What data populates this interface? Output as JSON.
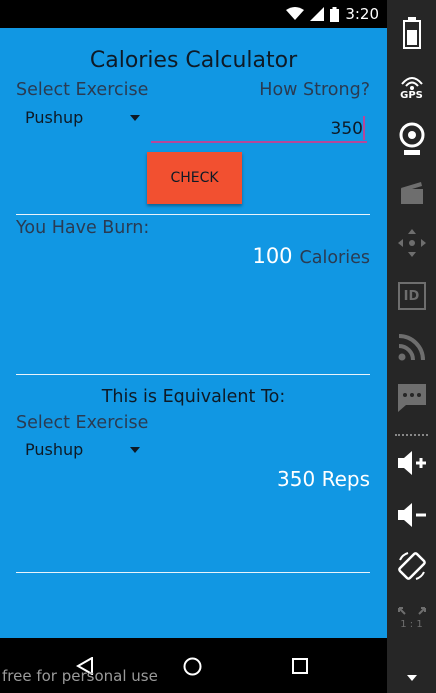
{
  "status_bar": {
    "time": "3:20"
  },
  "app": {
    "title": "Calories Calculator",
    "select_exercise_label": "Select Exercise",
    "strength_label": "How Strong?",
    "exercise_selected": "Pushup",
    "strength_value": "350",
    "check_button": "CHECK",
    "burn_label": "You Have Burn:",
    "calories_value": "100",
    "calories_unit": "Calories",
    "equivalent_label": "This is Equivalent To:",
    "select_exercise_label_2": "Select Exercise",
    "exercise_selected_2": "Pushup",
    "reps_text": "350 Reps"
  },
  "watermark": "free for personal use",
  "side_panel": {
    "gps_label": "GPS",
    "id_label": "ID",
    "ratio_label": "1 : 1"
  }
}
